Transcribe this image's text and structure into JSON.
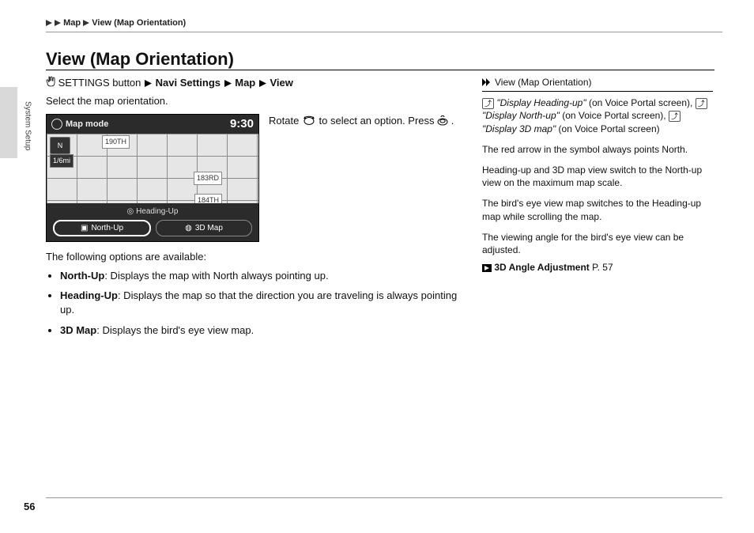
{
  "header": {
    "path_segment1": "Map",
    "path_segment2": "View (Map Orientation)"
  },
  "side_tab_label": "System Setup",
  "title": "View (Map Orientation)",
  "nav_line": {
    "settings_btn": "SETTINGS button",
    "s1": "Navi Settings",
    "s2": "Map",
    "s3": "View"
  },
  "intro": "Select the map orientation.",
  "screenshot": {
    "top_label": "Map mode",
    "clock": "9:30",
    "scale": "1/6mi",
    "street1": "190TH",
    "street2": "183RD",
    "street3": "184TH",
    "menu_title": "Heading-Up",
    "btn_north": "North-Up",
    "btn_3d": "3D Map"
  },
  "fig_caption_1": "Rotate ",
  "fig_caption_2": " to select an option. Press ",
  "fig_caption_3": ".",
  "following": "The following options are available:",
  "options": [
    {
      "name": "North-Up",
      "desc": ": Displays the map with North always pointing up."
    },
    {
      "name": "Heading-Up",
      "desc": ": Displays the map so that the direction you are traveling is always pointing up."
    },
    {
      "name": "3D Map",
      "desc": ": Displays the bird's eye view map."
    }
  ],
  "right": {
    "head": "View (Map Orientation)",
    "voice_lines": {
      "v1": "\"Display Heading-up\"",
      "v1_post": " (on Voice Portal screen), ",
      "v2": "\"Display North-up\"",
      "v2_post": " (on Voice Portal screen), ",
      "v3": "\"Display 3D map\"",
      "v3_post": " (on Voice Portal screen)"
    },
    "p1": "The red arrow in the symbol always points North.",
    "p2": "Heading-up and 3D map view switch to the North-up view on the maximum map scale.",
    "p3": "The bird's eye view map switches to the Heading-up map while scrolling the map.",
    "p4": "The viewing angle for the bird's eye view can be adjusted.",
    "link_label": "3D Angle Adjustment",
    "link_page": "P. 57"
  },
  "page_number": "56"
}
